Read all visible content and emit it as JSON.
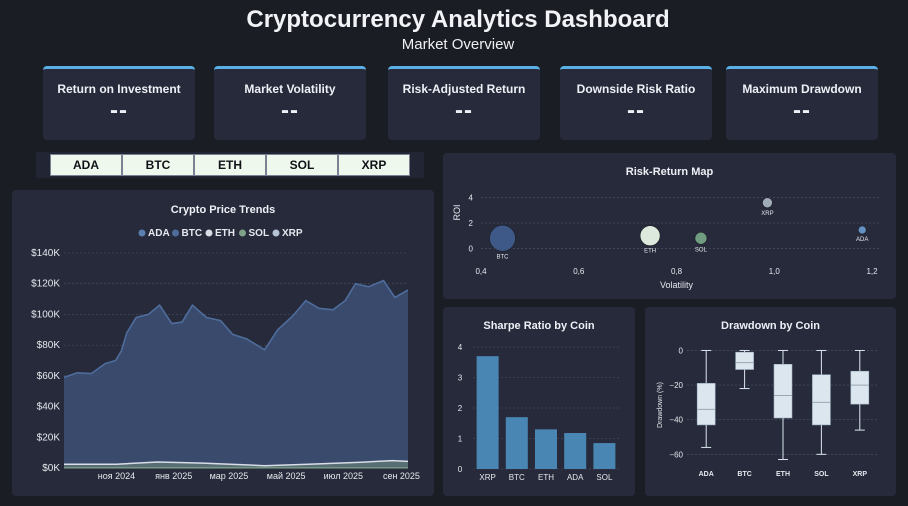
{
  "header": {
    "title": "Cryptocurrency Analytics Dashboard",
    "subtitle": "Market Overview"
  },
  "kpis": [
    {
      "label": "Return on Investment",
      "value": "--"
    },
    {
      "label": "Market Volatility",
      "value": "--"
    },
    {
      "label": "Risk-Adjusted Return",
      "value": "--"
    },
    {
      "label": "Downside Risk Ratio",
      "value": "--"
    },
    {
      "label": "Maximum Drawdown",
      "value": "--"
    }
  ],
  "coin_selector": [
    "ADA",
    "BTC",
    "ETH",
    "SOL",
    "XRP"
  ],
  "colors": {
    "btc_area": "#3d5075",
    "btc_line": "#4f6d9c",
    "eth_line": "#d8dde6",
    "other_line": "#7fa38a",
    "scatter_btc": "#3e5987",
    "scatter_eth": "#dde9dc",
    "scatter_sol": "#6f9c80",
    "scatter_xrp": "#a0adb8",
    "scatter_ada": "#6590c2",
    "bar": "#4a86b4",
    "box": "#dbe6ee"
  },
  "chart_data": [
    {
      "type": "area",
      "title": "Crypto Price Trends",
      "legend": [
        "ADA",
        "BTC",
        "ETH",
        "SOL",
        "XRP"
      ],
      "legend_position": "top",
      "x_ticks": [
        "ноя 2024",
        "янв 2025",
        "мар 2025",
        "май 2025",
        "июл 2025",
        "сен 2025"
      ],
      "y_ticks": [
        "$0K",
        "$20K",
        "$40K",
        "$60K",
        "$80K",
        "$100K",
        "$120K",
        "$140K"
      ],
      "ylim": [
        0,
        140000
      ],
      "x_range": [
        "2024-09-06",
        "2025-09-08"
      ],
      "series": [
        {
          "name": "BTC",
          "points": [
            [
              "2024-09-06",
              59000
            ],
            [
              "2024-09-20",
              62000
            ],
            [
              "2024-10-05",
              61500
            ],
            [
              "2024-10-20",
              68000
            ],
            [
              "2024-10-31",
              70000
            ],
            [
              "2024-11-06",
              76000
            ],
            [
              "2024-11-12",
              88000
            ],
            [
              "2024-11-22",
              98000
            ],
            [
              "2024-12-05",
              100000
            ],
            [
              "2024-12-17",
              106000
            ],
            [
              "2024-12-30",
              94000
            ],
            [
              "2025-01-10",
              95000
            ],
            [
              "2025-01-21",
              106000
            ],
            [
              "2025-02-05",
              98000
            ],
            [
              "2025-02-20",
              96000
            ],
            [
              "2025-03-05",
              87000
            ],
            [
              "2025-03-20",
              84000
            ],
            [
              "2025-04-08",
              77000
            ],
            [
              "2025-04-22",
              90000
            ],
            [
              "2025-05-08",
              99000
            ],
            [
              "2025-05-22",
              109000
            ],
            [
              "2025-06-05",
              104000
            ],
            [
              "2025-06-20",
              103000
            ],
            [
              "2025-07-03",
              109000
            ],
            [
              "2025-07-14",
              120000
            ],
            [
              "2025-07-28",
              118000
            ],
            [
              "2025-08-13",
              122000
            ],
            [
              "2025-08-25",
              111000
            ],
            [
              "2025-09-08",
              116000
            ]
          ]
        },
        {
          "name": "ETH",
          "points": [
            [
              "2024-09-06",
              2400
            ],
            [
              "2024-11-01",
              2500
            ],
            [
              "2024-12-15",
              3900
            ],
            [
              "2025-02-01",
              3200
            ],
            [
              "2025-04-08",
              1500
            ],
            [
              "2025-06-01",
              2600
            ],
            [
              "2025-07-20",
              3700
            ],
            [
              "2025-08-22",
              4800
            ],
            [
              "2025-09-08",
              4300
            ]
          ]
        },
        {
          "name": "SOL",
          "points": [
            [
              "2024-09-06",
              140
            ],
            [
              "2025-01-19",
              260
            ],
            [
              "2025-04-08",
              105
            ],
            [
              "2025-09-08",
              210
            ]
          ]
        },
        {
          "name": "ADA",
          "points": [
            [
              "2024-09-06",
              0.33
            ],
            [
              "2024-12-03",
              1.1
            ],
            [
              "2025-04-08",
              0.58
            ],
            [
              "2025-09-08",
              0.83
            ]
          ]
        },
        {
          "name": "XRP",
          "points": [
            [
              "2024-09-06",
              0.53
            ],
            [
              "2025-01-16",
              3.2
            ],
            [
              "2025-04-08",
              1.9
            ],
            [
              "2025-09-08",
              2.9
            ]
          ]
        }
      ]
    },
    {
      "type": "scatter",
      "title": "Risk-Return Map",
      "xlabel": "Volatility",
      "ylabel": "ROI",
      "xlim": [
        0.4,
        1.2
      ],
      "ylim": [
        -0.6,
        5
      ],
      "x_ticks": [
        "0,4",
        "0,6",
        "0,8",
        "1,0",
        "1,2"
      ],
      "y_ticks": [
        "0",
        "2",
        "4"
      ],
      "points": [
        {
          "label": "BTC",
          "x": 0.444,
          "y": 0.8,
          "size": 13
        },
        {
          "label": "ETH",
          "x": 0.746,
          "y": 1.0,
          "size": 10
        },
        {
          "label": "SOL",
          "x": 0.85,
          "y": 0.8,
          "size": 6
        },
        {
          "label": "XRP",
          "x": 0.986,
          "y": 3.6,
          "size": 5
        },
        {
          "label": "ADA",
          "x": 1.18,
          "y": 1.45,
          "size": 4
        }
      ]
    },
    {
      "type": "bar",
      "title": "Sharpe Ratio by Coin",
      "categories": [
        "XRP",
        "BTC",
        "ETH",
        "ADA",
        "SOL"
      ],
      "values": [
        3.7,
        1.7,
        1.3,
        1.18,
        0.85
      ],
      "ylim": [
        0,
        4
      ],
      "y_ticks": [
        "0",
        "1",
        "2",
        "3",
        "4"
      ]
    },
    {
      "type": "box",
      "title": "Drawdown by Coin",
      "ylabel": "Drawdown (%)",
      "ylim": [
        -65,
        2
      ],
      "y_ticks": [
        "0",
        "−20",
        "−40",
        "−60"
      ],
      "categories": [
        "ADA",
        "BTC",
        "ETH",
        "SOL",
        "XRP"
      ],
      "boxes": [
        {
          "min": -56,
          "q1": -43,
          "median": -34,
          "q3": -19,
          "max": 0
        },
        {
          "min": -22,
          "q1": -11,
          "median": -7,
          "q3": -1,
          "max": 0
        },
        {
          "min": -63,
          "q1": -39,
          "median": -26,
          "q3": -8,
          "max": 0
        },
        {
          "min": -60,
          "q1": -43,
          "median": -30,
          "q3": -14,
          "max": 0
        },
        {
          "min": -46,
          "q1": -31,
          "median": -20,
          "q3": -12,
          "max": 0
        }
      ]
    }
  ]
}
